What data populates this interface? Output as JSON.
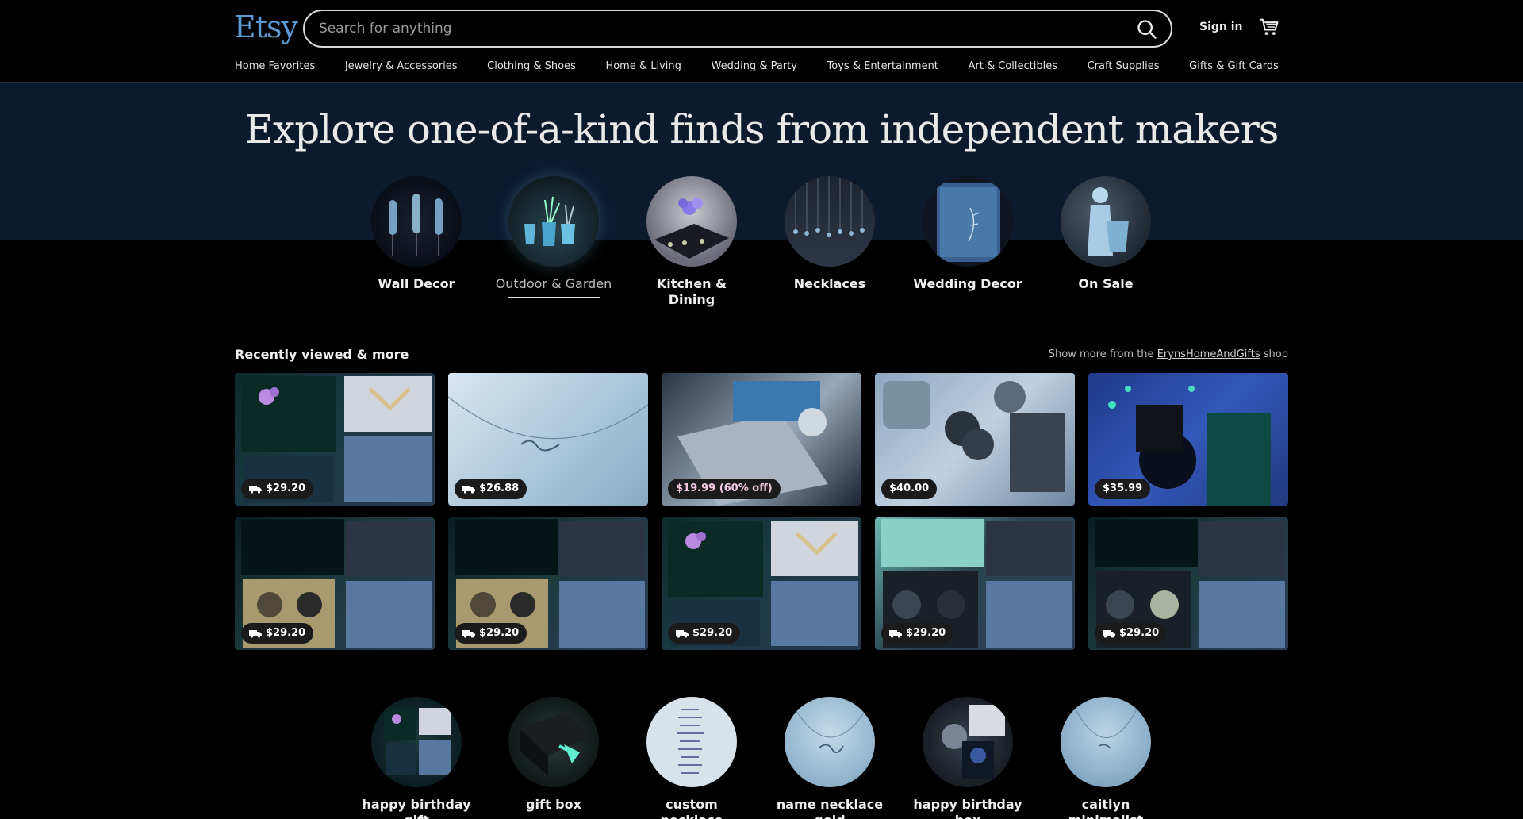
{
  "header": {
    "logo": "Etsy",
    "search_placeholder": "Search for anything",
    "signin": "Sign in",
    "categories": [
      "Home Favorites",
      "Jewelry & Accessories",
      "Clothing & Shoes",
      "Home & Living",
      "Wedding & Party",
      "Toys & Entertainment",
      "Art & Collectibles",
      "Craft Supplies",
      "Gifts & Gift Cards"
    ]
  },
  "hero": {
    "title": "Explore one-of-a-kind finds from independent makers",
    "circles": [
      {
        "label": "Wall Decor",
        "icon": "wall-decor-image"
      },
      {
        "label": "Outdoor & Garden",
        "icon": "outdoor-garden-image"
      },
      {
        "label": "Kitchen & Dining",
        "icon": "kitchen-dining-image"
      },
      {
        "label": "Necklaces",
        "icon": "necklaces-image"
      },
      {
        "label": "Wedding Decor",
        "icon": "wedding-decor-image"
      },
      {
        "label": "On Sale",
        "icon": "on-sale-image"
      }
    ]
  },
  "recent": {
    "title": "Recently viewed & more",
    "more_prefix": "Show more from the",
    "shop_name": "ErynsHomeAndGifts",
    "more_suffix": "shop",
    "items": [
      {
        "price": "$29.20",
        "shipping": true,
        "img": "birth-flower-box"
      },
      {
        "price": "$26.88",
        "shipping": true,
        "img": "name-necklace"
      },
      {
        "price": "$19.99 (60% off)",
        "shipping": false,
        "img": "passport-set"
      },
      {
        "price": "$40.00",
        "shipping": false,
        "img": "scrunchie-set"
      },
      {
        "price": "$35.99",
        "shipping": false,
        "img": "birthday-candle"
      },
      {
        "price": "$29.20",
        "shipping": true,
        "img": "happy-birthday-box-kate"
      },
      {
        "price": "$29.20",
        "shipping": true,
        "img": "happy-birthday-box-kate-2"
      },
      {
        "price": "$29.20",
        "shipping": true,
        "img": "birth-flower-box-2"
      },
      {
        "price": "$29.20",
        "shipping": true,
        "img": "hello-30-box"
      },
      {
        "price": "$29.20",
        "shipping": true,
        "img": "relax-box"
      }
    ]
  },
  "searches": [
    {
      "label": "happy birthday gift",
      "icon": "happy-birthday-gift-image"
    },
    {
      "label": "gift box",
      "icon": "gift-box-image"
    },
    {
      "label": "custom necklace",
      "icon": "custom-necklace-image"
    },
    {
      "label": "name necklace gold",
      "icon": "name-necklace-gold-image"
    },
    {
      "label": "happy birthday box",
      "icon": "happy-birthday-box-image"
    },
    {
      "label": "caitlyn minimalist",
      "icon": "caitlyn-minimalist-image"
    }
  ],
  "colors": {
    "logo": "#5b9bd5",
    "hero_bg": "#0c1a2e",
    "page_bg": "#000000"
  }
}
